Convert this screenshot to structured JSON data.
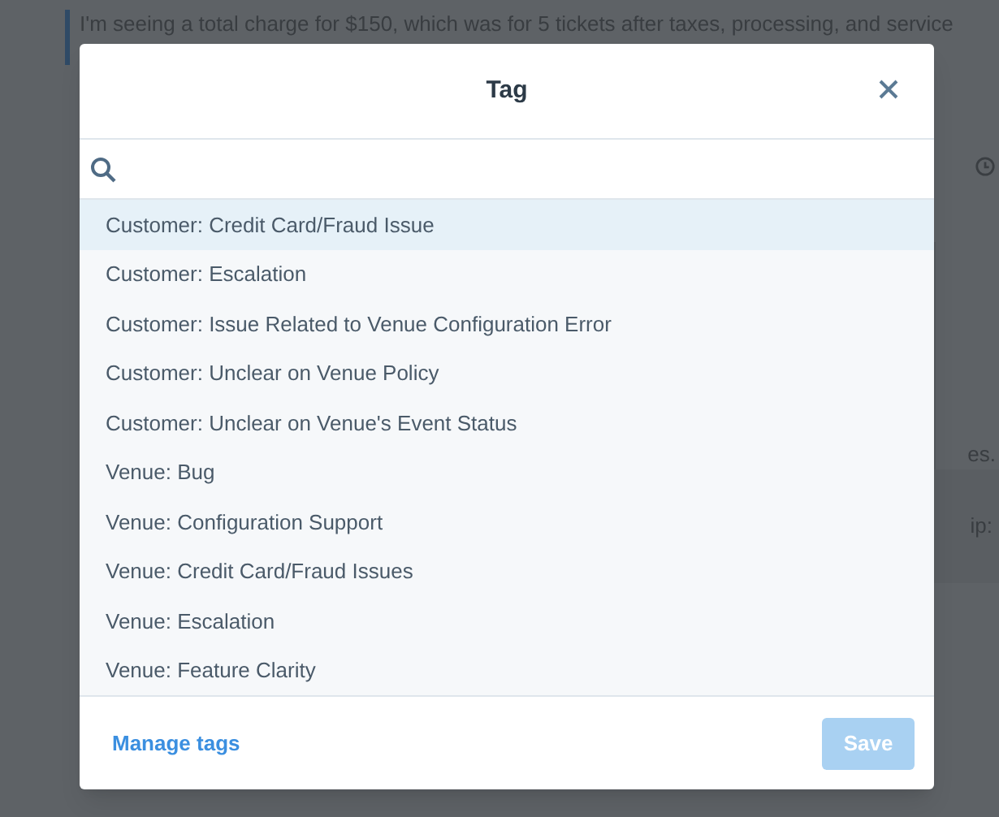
{
  "background": {
    "message": "I'm seeing a total charge for $150, which was for 5 tickets after taxes, processing, and service",
    "fragments": [
      "es.",
      "ip:"
    ]
  },
  "dialog": {
    "title": "Tag",
    "tags": [
      {
        "label": "Customer: Credit Card/Fraud Issue",
        "selected": true
      },
      {
        "label": "Customer: Escalation",
        "selected": false
      },
      {
        "label": "Customer: Issue Related to Venue Configuration Error",
        "selected": false
      },
      {
        "label": "Customer: Unclear on Venue Policy",
        "selected": false
      },
      {
        "label": "Customer: Unclear on Venue's Event Status",
        "selected": false
      },
      {
        "label": "Venue: Bug",
        "selected": false
      },
      {
        "label": "Venue: Configuration Support",
        "selected": false
      },
      {
        "label": "Venue: Credit Card/Fraud Issues",
        "selected": false
      },
      {
        "label": "Venue: Escalation",
        "selected": false
      },
      {
        "label": "Venue: Feature Clarity",
        "selected": false
      }
    ],
    "manage_link": "Manage tags",
    "save_button": {
      "label": "Save",
      "disabled": true
    }
  }
}
